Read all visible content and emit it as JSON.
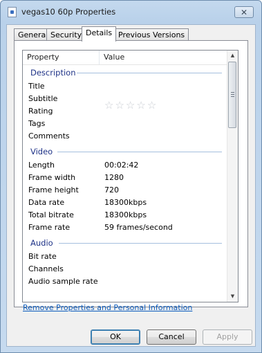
{
  "window": {
    "title": "vegas10 60p Properties",
    "close_label": "✕"
  },
  "tabs": [
    {
      "label": "General"
    },
    {
      "label": "Security"
    },
    {
      "label": "Details",
      "active": true
    },
    {
      "label": "Previous Versions"
    }
  ],
  "list": {
    "headers": {
      "property": "Property",
      "value": "Value"
    },
    "groups": {
      "description": {
        "label": "Description",
        "rows": [
          {
            "property": "Title",
            "value": ""
          },
          {
            "property": "Subtitle",
            "value": ""
          },
          {
            "property": "Rating",
            "value": "",
            "rating_stars": 0,
            "rating_max": 5
          },
          {
            "property": "Tags",
            "value": ""
          },
          {
            "property": "Comments",
            "value": ""
          }
        ]
      },
      "video": {
        "label": "Video",
        "rows": [
          {
            "property": "Length",
            "value": "00:02:42"
          },
          {
            "property": "Frame width",
            "value": "1280"
          },
          {
            "property": "Frame height",
            "value": "720"
          },
          {
            "property": "Data rate",
            "value": "18300kbps"
          },
          {
            "property": "Total bitrate",
            "value": "18300kbps"
          },
          {
            "property": "Frame rate",
            "value": "59 frames/second"
          }
        ]
      },
      "audio": {
        "label": "Audio",
        "rows": [
          {
            "property": "Bit rate",
            "value": ""
          },
          {
            "property": "Channels",
            "value": ""
          },
          {
            "property": "Audio sample rate",
            "value": ""
          }
        ]
      }
    }
  },
  "remove_link": "Remove Properties and Personal Information",
  "buttons": {
    "ok": "OK",
    "cancel": "Cancel",
    "apply": "Apply"
  },
  "icons": {
    "star": "☆",
    "scroll_up": "▲",
    "scroll_down": "▼"
  }
}
